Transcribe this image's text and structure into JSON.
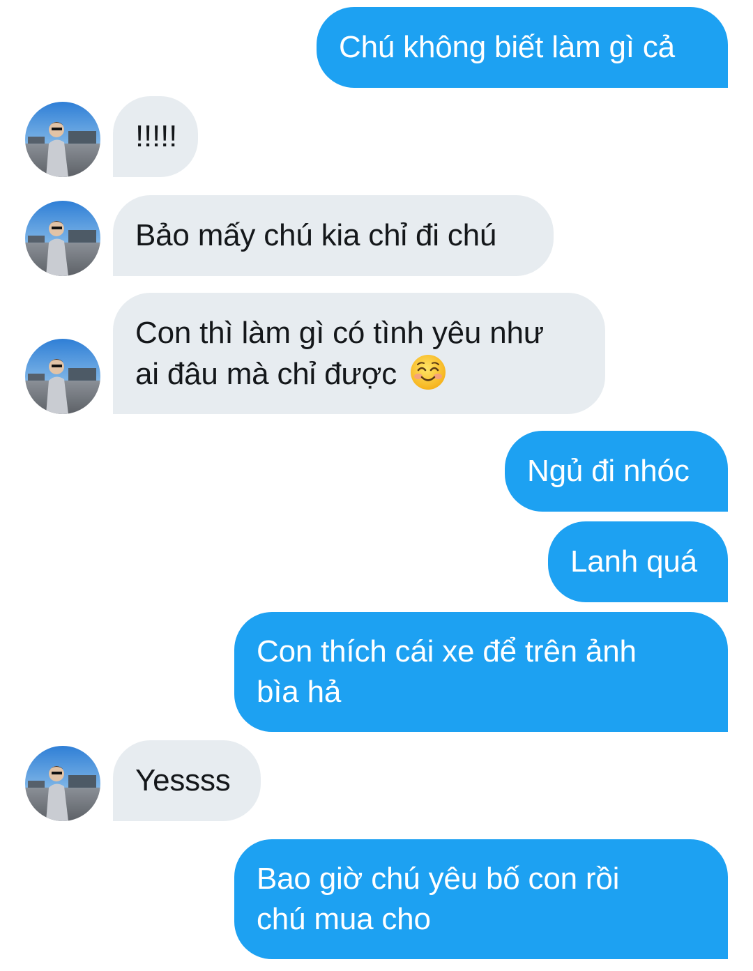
{
  "conversation": {
    "messages": [
      {
        "sender": "me",
        "text": "Chú không biết làm gì cả"
      },
      {
        "sender": "them",
        "text": "!!!!!"
      },
      {
        "sender": "them",
        "text": "Bảo mấy chú kia chỉ đi chú"
      },
      {
        "sender": "them",
        "text_line1": "Con thì làm gì có tình yêu như",
        "text_line2": "ai đâu mà chỉ được",
        "emoji": "smiling-face-with-smiling-eyes-icon"
      },
      {
        "sender": "me",
        "text": "Ngủ đi nhóc"
      },
      {
        "sender": "me",
        "text": "Lanh quá"
      },
      {
        "sender": "me",
        "text_line1": "Con thích cái xe để trên ảnh",
        "text_line2": "bìa hả"
      },
      {
        "sender": "them",
        "text": "Yessss"
      },
      {
        "sender": "me",
        "text_line1": "Bao giờ chú yêu bố con rồi",
        "text_line2": "chú mua cho"
      }
    ]
  },
  "colors": {
    "outgoing_bubble": "#1da1f2",
    "incoming_bubble": "#e7ecf0",
    "outgoing_text": "#ffffff",
    "incoming_text": "#14171a",
    "background": "#ffffff"
  }
}
